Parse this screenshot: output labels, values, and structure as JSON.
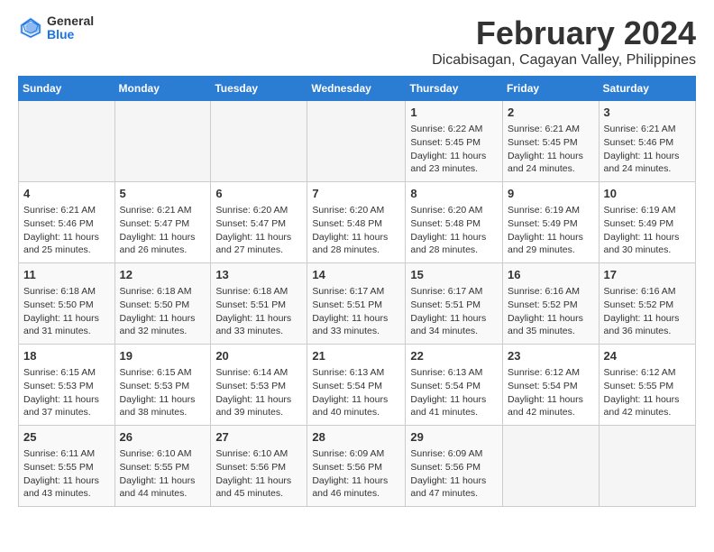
{
  "header": {
    "logo_general": "General",
    "logo_blue": "Blue",
    "month_year": "February 2024",
    "location": "Dicabisagan, Cagayan Valley, Philippines"
  },
  "calendar": {
    "days_of_week": [
      "Sunday",
      "Monday",
      "Tuesday",
      "Wednesday",
      "Thursday",
      "Friday",
      "Saturday"
    ],
    "weeks": [
      [
        {
          "day": "",
          "content": ""
        },
        {
          "day": "",
          "content": ""
        },
        {
          "day": "",
          "content": ""
        },
        {
          "day": "",
          "content": ""
        },
        {
          "day": "1",
          "content": "Sunrise: 6:22 AM\nSunset: 5:45 PM\nDaylight: 11 hours and 23 minutes."
        },
        {
          "day": "2",
          "content": "Sunrise: 6:21 AM\nSunset: 5:45 PM\nDaylight: 11 hours and 24 minutes."
        },
        {
          "day": "3",
          "content": "Sunrise: 6:21 AM\nSunset: 5:46 PM\nDaylight: 11 hours and 24 minutes."
        }
      ],
      [
        {
          "day": "4",
          "content": "Sunrise: 6:21 AM\nSunset: 5:46 PM\nDaylight: 11 hours and 25 minutes."
        },
        {
          "day": "5",
          "content": "Sunrise: 6:21 AM\nSunset: 5:47 PM\nDaylight: 11 hours and 26 minutes."
        },
        {
          "day": "6",
          "content": "Sunrise: 6:20 AM\nSunset: 5:47 PM\nDaylight: 11 hours and 27 minutes."
        },
        {
          "day": "7",
          "content": "Sunrise: 6:20 AM\nSunset: 5:48 PM\nDaylight: 11 hours and 28 minutes."
        },
        {
          "day": "8",
          "content": "Sunrise: 6:20 AM\nSunset: 5:48 PM\nDaylight: 11 hours and 28 minutes."
        },
        {
          "day": "9",
          "content": "Sunrise: 6:19 AM\nSunset: 5:49 PM\nDaylight: 11 hours and 29 minutes."
        },
        {
          "day": "10",
          "content": "Sunrise: 6:19 AM\nSunset: 5:49 PM\nDaylight: 11 hours and 30 minutes."
        }
      ],
      [
        {
          "day": "11",
          "content": "Sunrise: 6:18 AM\nSunset: 5:50 PM\nDaylight: 11 hours and 31 minutes."
        },
        {
          "day": "12",
          "content": "Sunrise: 6:18 AM\nSunset: 5:50 PM\nDaylight: 11 hours and 32 minutes."
        },
        {
          "day": "13",
          "content": "Sunrise: 6:18 AM\nSunset: 5:51 PM\nDaylight: 11 hours and 33 minutes."
        },
        {
          "day": "14",
          "content": "Sunrise: 6:17 AM\nSunset: 5:51 PM\nDaylight: 11 hours and 33 minutes."
        },
        {
          "day": "15",
          "content": "Sunrise: 6:17 AM\nSunset: 5:51 PM\nDaylight: 11 hours and 34 minutes."
        },
        {
          "day": "16",
          "content": "Sunrise: 6:16 AM\nSunset: 5:52 PM\nDaylight: 11 hours and 35 minutes."
        },
        {
          "day": "17",
          "content": "Sunrise: 6:16 AM\nSunset: 5:52 PM\nDaylight: 11 hours and 36 minutes."
        }
      ],
      [
        {
          "day": "18",
          "content": "Sunrise: 6:15 AM\nSunset: 5:53 PM\nDaylight: 11 hours and 37 minutes."
        },
        {
          "day": "19",
          "content": "Sunrise: 6:15 AM\nSunset: 5:53 PM\nDaylight: 11 hours and 38 minutes."
        },
        {
          "day": "20",
          "content": "Sunrise: 6:14 AM\nSunset: 5:53 PM\nDaylight: 11 hours and 39 minutes."
        },
        {
          "day": "21",
          "content": "Sunrise: 6:13 AM\nSunset: 5:54 PM\nDaylight: 11 hours and 40 minutes."
        },
        {
          "day": "22",
          "content": "Sunrise: 6:13 AM\nSunset: 5:54 PM\nDaylight: 11 hours and 41 minutes."
        },
        {
          "day": "23",
          "content": "Sunrise: 6:12 AM\nSunset: 5:54 PM\nDaylight: 11 hours and 42 minutes."
        },
        {
          "day": "24",
          "content": "Sunrise: 6:12 AM\nSunset: 5:55 PM\nDaylight: 11 hours and 42 minutes."
        }
      ],
      [
        {
          "day": "25",
          "content": "Sunrise: 6:11 AM\nSunset: 5:55 PM\nDaylight: 11 hours and 43 minutes."
        },
        {
          "day": "26",
          "content": "Sunrise: 6:10 AM\nSunset: 5:55 PM\nDaylight: 11 hours and 44 minutes."
        },
        {
          "day": "27",
          "content": "Sunrise: 6:10 AM\nSunset: 5:56 PM\nDaylight: 11 hours and 45 minutes."
        },
        {
          "day": "28",
          "content": "Sunrise: 6:09 AM\nSunset: 5:56 PM\nDaylight: 11 hours and 46 minutes."
        },
        {
          "day": "29",
          "content": "Sunrise: 6:09 AM\nSunset: 5:56 PM\nDaylight: 11 hours and 47 minutes."
        },
        {
          "day": "",
          "content": ""
        },
        {
          "day": "",
          "content": ""
        }
      ]
    ]
  }
}
